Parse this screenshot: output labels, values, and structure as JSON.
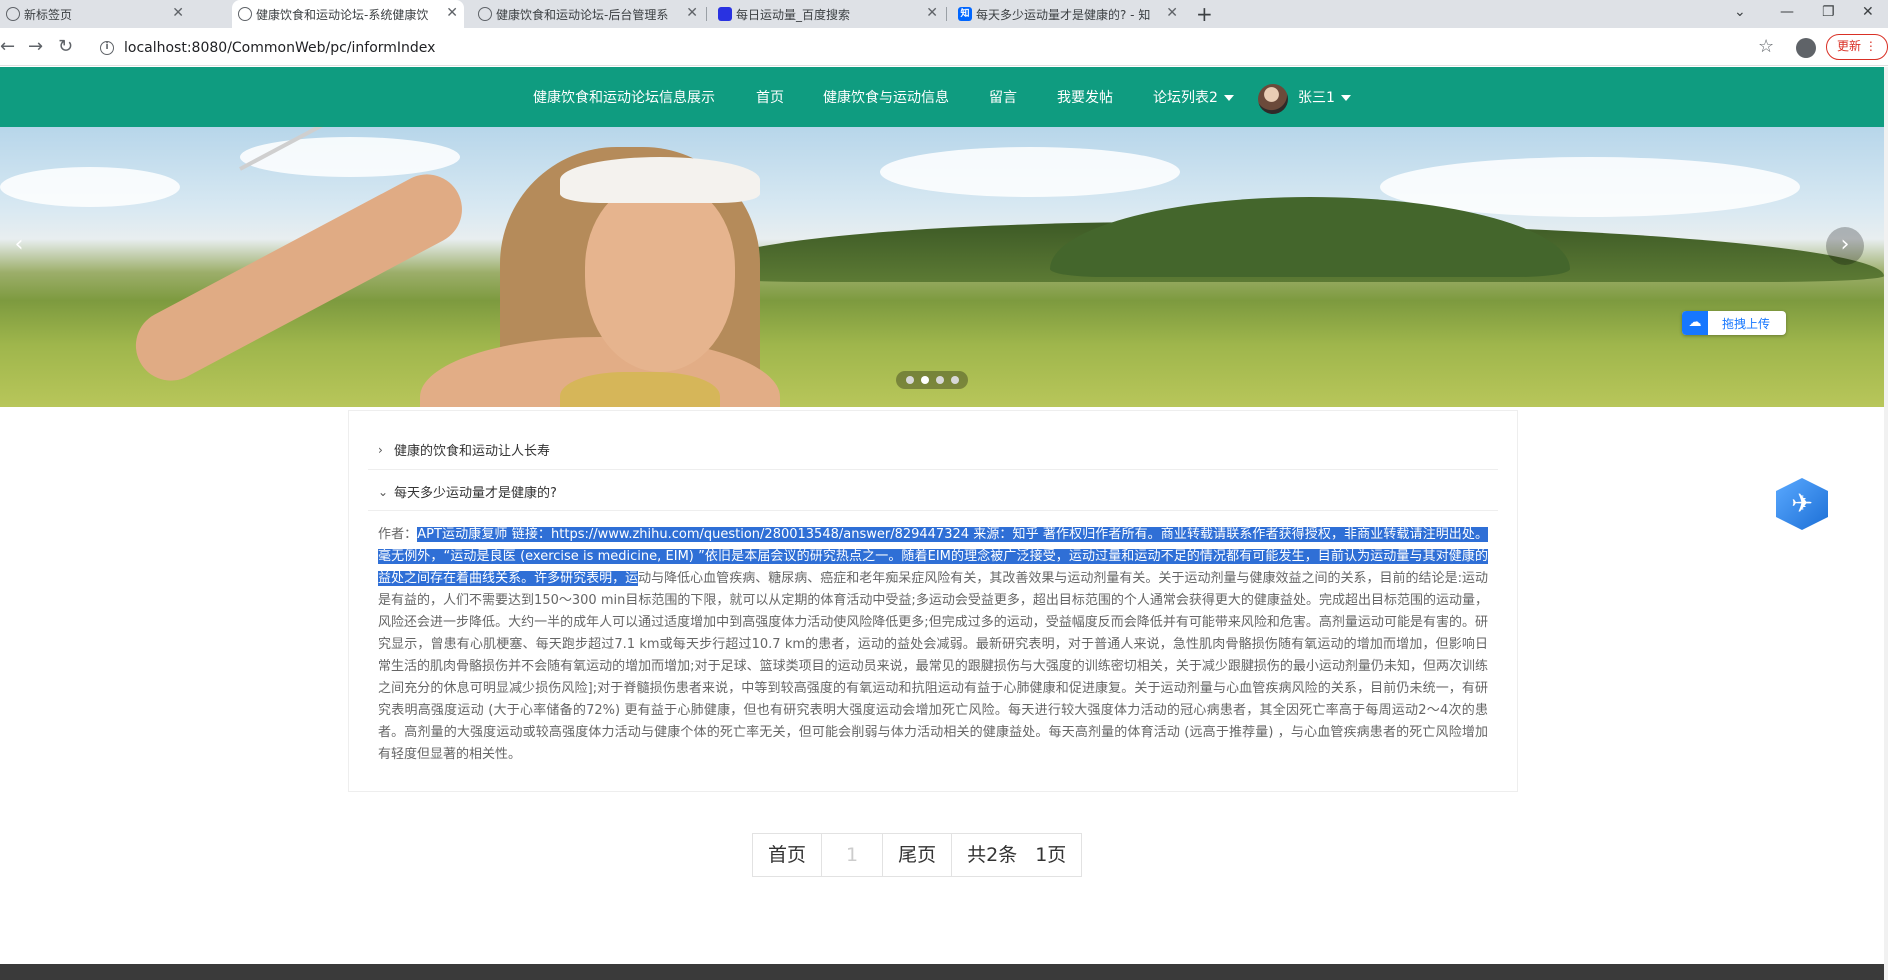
{
  "browser": {
    "tabs": [
      {
        "title": "新标签页",
        "active": false
      },
      {
        "title": "健康饮食和运动论坛-系统健康饮",
        "active": true
      },
      {
        "title": "健康饮食和运动论坛-后台管理系",
        "active": false
      },
      {
        "title": "每日运动量_百度搜索",
        "active": false
      },
      {
        "title": "每天多少运动量才是健康的? - 知",
        "active": false
      }
    ],
    "new_tab": "+",
    "url": "localhost:8080/CommonWeb/pc/informIndex",
    "update_label": "更新"
  },
  "nav": {
    "site_title": "健康饮食和运动论坛信息展示",
    "items": [
      "首页",
      "健康饮食与运动信息",
      "留言",
      "我要发帖"
    ],
    "forum_dropdown": "论坛列表2",
    "user_name": "张三1",
    "accent_color": "#0f9c80"
  },
  "banner": {
    "upload_label": "拖拽上传",
    "dots": 4,
    "active_dot": 2
  },
  "collapse": {
    "items": [
      {
        "title": "健康的饮食和运动让人长寿",
        "expanded": false
      },
      {
        "title": "每天多少运动量才是健康的?",
        "expanded": true
      }
    ],
    "article_label": "作者：",
    "article_highlighted": "APT运动康复师 链接：https://www.zhihu.com/question/280013548/answer/829447324 来源：知乎 著作权归作者所有。商业转载请联系作者获得授权，非商业转载请注明出处。 毫无例外，“运动是良医 (exercise is medicine, EIM) ”依旧是本届会议的研究热点之一。随着EIM的理念被广泛接受，运动过量和运动不足的情况都有可能发生，目前认为运动量与其对健康的益处之间存在着曲线关系。许多研究表明，运",
    "article_rest": "动与降低心血管疾病、糖尿病、癌症和老年痴呆症风险有关，其改善效果与运动剂量有关。关于运动剂量与健康效益之间的关系，目前的结论是:运动是有益的，人们不需要达到150～300 min目标范围的下限，就可以从定期的体育活动中受益;多运动会受益更多，超出目标范围的个人通常会获得更大的健康益处。完成超出目标范围的运动量，风险还会进一步降低。大约一半的成年人可以通过适度增加中到高强度体力活动使风险降低更多;但完成过多的运动，受益幅度反而会降低并有可能带来风险和危害。高剂量运动可能是有害的。研究显示，曾患有心肌梗塞、每天跑步超过7.1 km或每天步行超过10.7 km的患者，运动的益处会减弱。最新研究表明，对于普通人来说，急性肌肉骨骼损伤随有氧运动的增加而增加，但影响日常生活的肌肉骨骼损伤并不会随有氧运动的增加而增加;对于足球、篮球类项目的运动员来说，最常见的跟腱损伤与大强度的训练密切相关，关于减少跟腱损伤的最小运动剂量仍未知，但两次训练之间充分的休息可明显减少损伤风险];对于脊髓损伤患者来说，中等到较高强度的有氧运动和抗阻运动有益于心肺健康和促进康复。关于运动剂量与心血管疾病风险的关系，目前仍未统一，有研究表明高强度运动 (大于心率储备的72%) 更有益于心肺健康，但也有研究表明大强度运动会增加死亡风险。每天进行较大强度体力活动的冠心病患者，其全因死亡率高于每周运动2～4次的患者。高剂量的大强度运动或较高强度体力活动与健康个体的死亡率无关，但可能会削弱与体力活动相关的健康益处。每天高剂量的体育活动 (远高于推荐量) ，与心血管疾病患者的死亡风险增加有轻度但显著的相关性。",
    "highlight_color": "#2f6fd6"
  },
  "pager": {
    "first": "首页",
    "current": "1",
    "last": "尾页",
    "total": "共2条",
    "pages": "1页"
  }
}
